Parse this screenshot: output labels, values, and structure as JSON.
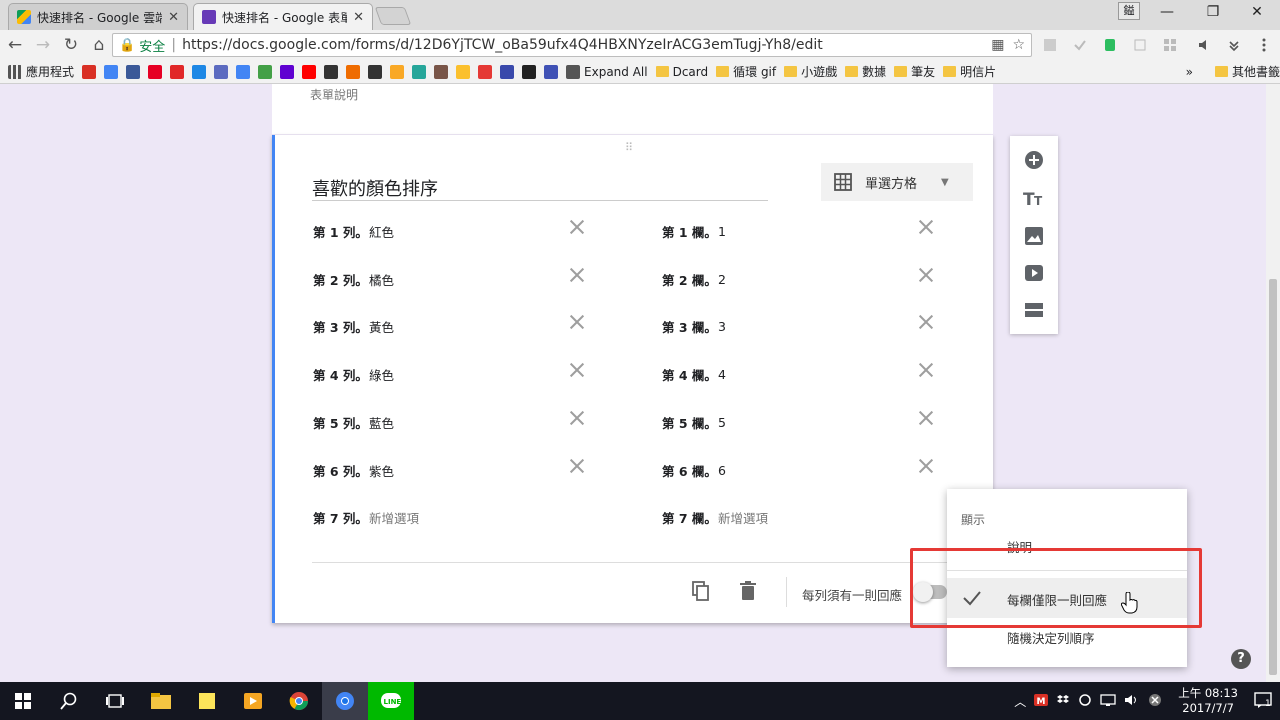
{
  "browser": {
    "tabs": [
      {
        "title": "快速排名 - Google 雲端硬",
        "close": "✕"
      },
      {
        "title": "快速排名 - Google 表單",
        "close": "✕"
      }
    ],
    "profile_label": "鎰",
    "window_controls": {
      "minimize": "—",
      "restore": "❐",
      "close": "✕"
    },
    "nav": {
      "back": "←",
      "forward": "→",
      "reload": "↻",
      "home": "⌂"
    },
    "omnibox": {
      "secure_icon": "🔒",
      "secure_label": "安全",
      "separator": "|",
      "url": "https://docs.google.com/forms/d/12D6YjTCW_oBa59ufx4Q4HBXNYzeIrACG3emTugj-Yh8/edit",
      "qr_icon": "▦",
      "star_icon": "☆"
    },
    "bookmarks": [
      {
        "label": "應用程式",
        "icon": "apps-icon",
        "color": "#555555"
      },
      {
        "label": "",
        "icon": "gmail-icon",
        "color": "#d93025"
      },
      {
        "label": "",
        "icon": "google-icon",
        "color": "#4285f4"
      },
      {
        "label": "",
        "icon": "facebook-icon",
        "color": "#3b5998"
      },
      {
        "label": "",
        "icon": "pinterest-icon",
        "color": "#e60023"
      },
      {
        "label": "",
        "icon": "flipboard-icon",
        "color": "#e12828"
      },
      {
        "label": "",
        "icon": "d-icon",
        "color": "#1e88e5"
      },
      {
        "label": "",
        "icon": "mail-icon",
        "color": "#5c6bc0"
      },
      {
        "label": "",
        "icon": "translate-icon",
        "color": "#4285f4"
      },
      {
        "label": "",
        "icon": "photo-icon",
        "color": "#43a047"
      },
      {
        "label": "",
        "icon": "yahoo-icon",
        "color": "#5f01d1"
      },
      {
        "label": "",
        "icon": "youtube-icon",
        "color": "#ff0000"
      },
      {
        "label": "",
        "icon": "s-icon",
        "color": "#333333"
      },
      {
        "label": "",
        "icon": "diamond-icon",
        "color": "#ef6c00"
      },
      {
        "label": "",
        "icon": "bird-icon",
        "color": "#333333"
      },
      {
        "label": "",
        "icon": "smile-icon",
        "color": "#f9a825"
      },
      {
        "label": "",
        "icon": "m-icon",
        "color": "#26a69a"
      },
      {
        "label": "",
        "icon": "z-icon",
        "color": "#795548"
      },
      {
        "label": "",
        "icon": "note-icon",
        "color": "#fbc02d"
      },
      {
        "label": "",
        "icon": "c-icon",
        "color": "#e53935"
      },
      {
        "label": "",
        "icon": "e-icon",
        "color": "#3949ab"
      },
      {
        "label": "",
        "icon": "wiki-icon",
        "color": "#222222"
      },
      {
        "label": "",
        "icon": "star-icon",
        "color": "#3f51b5"
      },
      {
        "label": "Expand All",
        "icon": "expand-icon",
        "color": "#555555"
      },
      {
        "label": "Dcard",
        "icon": "folder-icon",
        "color": "#f4c542"
      },
      {
        "label": "循環 gif",
        "icon": "folder-icon",
        "color": "#f4c542"
      },
      {
        "label": "小遊戲",
        "icon": "folder-icon",
        "color": "#f4c542"
      },
      {
        "label": "數據",
        "icon": "folder-icon",
        "color": "#f4c542"
      },
      {
        "label": "筆友",
        "icon": "folder-icon",
        "color": "#f4c542"
      },
      {
        "label": "明信片",
        "icon": "folder-icon",
        "color": "#f4c542"
      }
    ],
    "bookmarks_overflow": "»",
    "other_bookmarks": "其他書籤"
  },
  "form": {
    "description_placeholder": "表單說明",
    "drag_handle": "⠿",
    "question_title": "喜歡的顏色排序",
    "question_type": "單選方格",
    "rows": [
      {
        "label": "第 1 列。",
        "value": "紅色"
      },
      {
        "label": "第 2 列。",
        "value": "橘色"
      },
      {
        "label": "第 3 列。",
        "value": "黃色"
      },
      {
        "label": "第 4 列。",
        "value": "綠色"
      },
      {
        "label": "第 5 列。",
        "value": "藍色"
      },
      {
        "label": "第 6 列。",
        "value": "紫色"
      },
      {
        "label": "第 7 列。",
        "value": "新增選項"
      }
    ],
    "columns": [
      {
        "label": "第 1 欄。",
        "value": "1"
      },
      {
        "label": "第 2 欄。",
        "value": "2"
      },
      {
        "label": "第 3 欄。",
        "value": "3"
      },
      {
        "label": "第 4 欄。",
        "value": "4"
      },
      {
        "label": "第 5 欄。",
        "value": "5"
      },
      {
        "label": "第 6 欄。",
        "value": "6"
      },
      {
        "label": "第 7 欄。",
        "value": "新增選項"
      }
    ],
    "required_label": "每列須有一則回應",
    "required_on": false,
    "accent_color": "#4285f4"
  },
  "menu": {
    "header": "顯示",
    "items": [
      {
        "label": "說明",
        "checked": false
      },
      {
        "label": "每欄僅限一則回應",
        "checked": true
      },
      {
        "label": "隨機決定列順序",
        "checked": false
      }
    ],
    "highlight_color": "#e53935"
  },
  "help_label": "?",
  "taskbar": {
    "time": "上午 08:13",
    "date": "2017/7/7",
    "tray_arrow": "︿",
    "notification_count": "1"
  }
}
